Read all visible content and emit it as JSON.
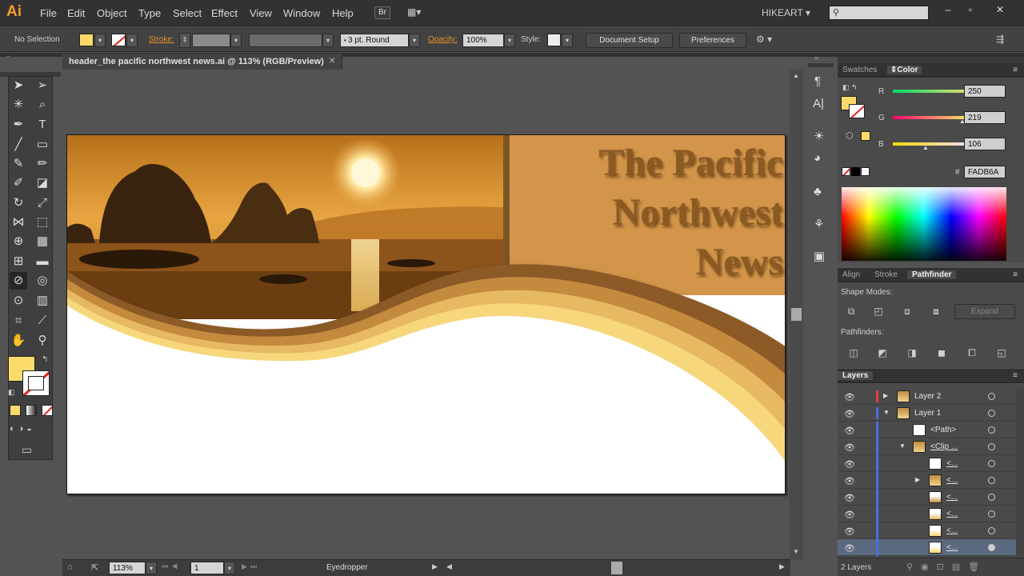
{
  "app": {
    "logo": "Ai"
  },
  "menu": [
    "File",
    "Edit",
    "Object",
    "Type",
    "Select",
    "Effect",
    "View",
    "Window",
    "Help"
  ],
  "bridge_label": "Br",
  "workspace": "HIKEART",
  "control": {
    "selection": "No Selection",
    "stroke_label": "Stroke:",
    "brush": "3 pt. Round",
    "opacity_label": "Opacity:",
    "opacity": "100%",
    "style_label": "Style:",
    "document_setup": "Document Setup",
    "preferences": "Preferences"
  },
  "document": {
    "tab_title": "header_the pacific northwest news.ai @ 113% (RGB/Preview)",
    "headline": [
      "The Pacific",
      "Northwest",
      "News"
    ]
  },
  "status": {
    "zoom": "113%",
    "artboard": "1",
    "tool": "Eyedropper"
  },
  "swatches_panel": {
    "tabs": [
      "Swatches",
      "Color"
    ],
    "r_label": "R",
    "r": "250",
    "g_label": "G",
    "g": "219",
    "b_label": "B",
    "b": "106",
    "hex_label": "#",
    "hex": "FADB6A"
  },
  "pathfinder_panel": {
    "tabs": [
      "Align",
      "Stroke",
      "Pathfinder"
    ],
    "shape_modes": "Shape Modes:",
    "expand": "Expand",
    "pathfinders": "Pathfinders:"
  },
  "layers_panel": {
    "title": "Layers",
    "rows": [
      {
        "name": "Layer 2"
      },
      {
        "name": "Layer 1"
      },
      {
        "name": "<Path>"
      },
      {
        "name": "<Clip ..."
      },
      {
        "name": "<..."
      },
      {
        "name": "<..."
      },
      {
        "name": "<..."
      },
      {
        "name": "<..."
      },
      {
        "name": "<..."
      },
      {
        "name": "<..."
      }
    ],
    "count": "2 Layers"
  },
  "colors": {
    "fill": "#FADB6A",
    "accent": "#e4902a",
    "headline": "#8a5a22"
  }
}
